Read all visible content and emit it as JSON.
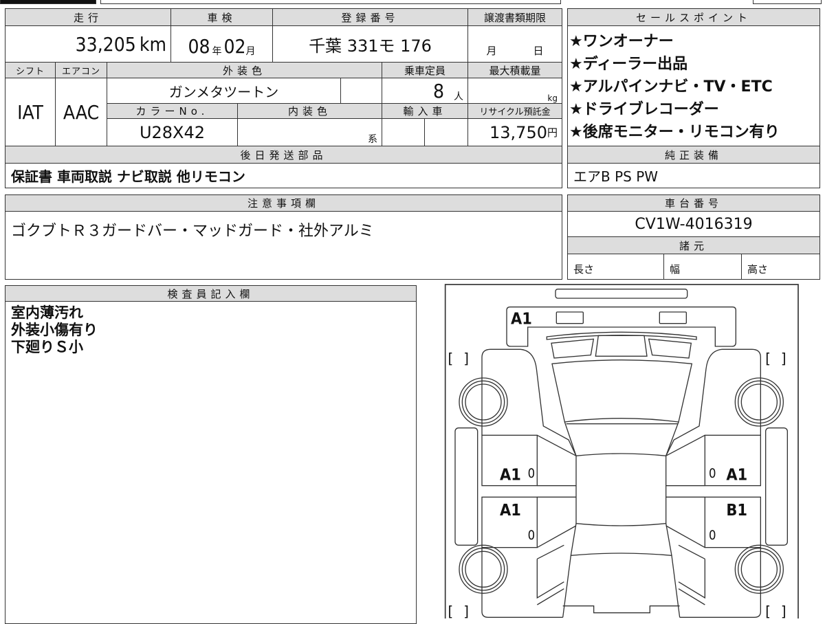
{
  "sheet": {
    "mileage": {
      "label": "走行",
      "value": "33,205",
      "unit": "km"
    },
    "inspection": {
      "label": "車検",
      "year": "08",
      "year_unit": "年",
      "month": "02",
      "month_unit": "月"
    },
    "registration": {
      "label": "登録番号",
      "value": "千葉 331モ 176"
    },
    "transfer_deadline": {
      "label": "譲渡書類期限",
      "month_unit": "月",
      "day_unit": "日"
    },
    "shift": {
      "label": "シフト",
      "value": "IAT"
    },
    "aircon": {
      "label": "エアコン",
      "value": "AAC"
    },
    "exterior_color": {
      "label": "外装色",
      "value": "ガンメタツートン"
    },
    "capacity": {
      "label": "乗車定員",
      "value": "8",
      "unit": "人"
    },
    "max_load": {
      "label": "最大積載量",
      "unit": "kg"
    },
    "color_no": {
      "label": "カラーNo.",
      "value": "U28X42"
    },
    "interior_color": {
      "label": "内装色",
      "unit": "系"
    },
    "imported": {
      "label": "輸入車"
    },
    "recycle": {
      "label": "リサイクル預託金",
      "value": "13,750",
      "unit": "円"
    },
    "later_parts": {
      "label": "後日発送部品",
      "value": "保証書 車両取説 ナビ取説 他リモコン"
    },
    "notes": {
      "label": "注意事項欄",
      "value": "ゴクブトＲ３ガードバー・マッドガード・社外アルミ"
    },
    "inspector": {
      "label": "検査員記入欄",
      "value": "室内薄汚れ\n外装小傷有り\n下廻りＳ小"
    }
  },
  "sales_points": {
    "label": "セールスポイント",
    "items": [
      "★ワンオーナー",
      "★ディーラー出品",
      "★アルパインナビ・TV・ETC",
      "★ドライブレコーダー",
      "★後席モニター・リモコン有り"
    ]
  },
  "equipment": {
    "label": "純正装備",
    "value": "エアB PS PW"
  },
  "chassis": {
    "label": "車台番号",
    "value": "CV1W-4016319"
  },
  "specs": {
    "label": "諸元",
    "length": "長さ",
    "width": "幅",
    "height": "高さ"
  },
  "diagram": {
    "marks": {
      "front": "A1",
      "left_front": "A1",
      "left_front_num": "0",
      "left_rear": "A1",
      "left_rear_num": "0",
      "right_front": "A1",
      "right_front_num": "0",
      "right_rear": "B1",
      "right_rear_num": "0"
    },
    "bracket": "[        ]"
  }
}
